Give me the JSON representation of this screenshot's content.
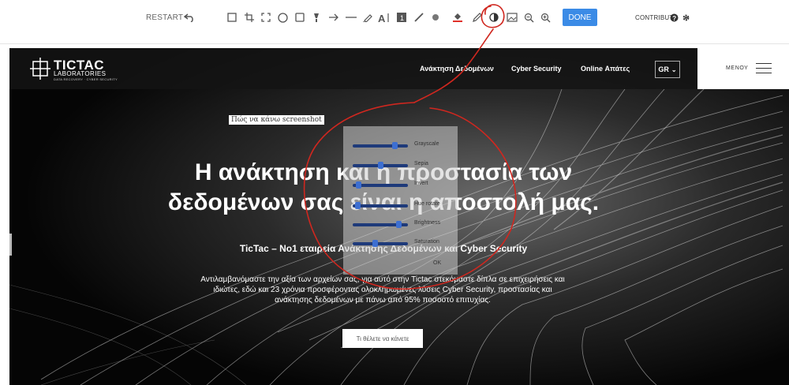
{
  "toolbar": {
    "restart_label": "RESTART",
    "done_label": "DONE",
    "contribute_label": "CONTRIBUTE",
    "tools": [
      "undo-icon",
      "rectangle-select-icon",
      "crop-icon",
      "fit-icon",
      "circle-icon",
      "square-icon",
      "highlight-icon",
      "arrow-icon",
      "line-icon",
      "pen-icon",
      "text-icon",
      "number-icon",
      "blur-icon",
      "dot-icon",
      "fill-icon",
      "pencil-icon",
      "filter-icon",
      "image-icon",
      "zoom-out-icon",
      "zoom-in-icon"
    ]
  },
  "site": {
    "logo_main": "TICTAC",
    "logo_sub": "LABORATORIES",
    "logo_tag": "DATA RECOVERY · CYBER SECURITY",
    "nav": [
      "Ανάκτηση Δεδομένων",
      "Cyber Security",
      "Online Απάτες"
    ],
    "lang": "GR",
    "menu_label": "ΜΕΝΟΥ"
  },
  "hero": {
    "screenshot_tag": "Πώς να κάνω screenshot",
    "title_line1": "Η ανάκτηση και η προστασία των",
    "title_line2": "δεδομένων σας είναι η αποστολή μας.",
    "subtitle": "TicTac – No1 εταιρεία Ανάκτησης Δεδομένων και Cyber Security",
    "paragraph": "Αντιλαμβανόμαστε την αξία των αρχείων σας, για αυτό στην Tictac στεκόμαστε δίπλα σε επιχειρήσεις και ιδιώτες, εδώ και 23 χρόνια προσφέροντας ολοκληρωμένες λύσεις Cyber Security, προστασίας και ανάκτησης δεδομένων με πάνω από 95% ποσοστό επιτυχίας.",
    "cta": "Τι θέλετε να κάνετε"
  },
  "filters": {
    "items": [
      {
        "label": "Grayscale",
        "value": 0.8
      },
      {
        "label": "Sepia",
        "value": 0.5
      },
      {
        "label": "Invert",
        "value": 0.07
      },
      {
        "label": "Hue rotate",
        "value": 0.05
      },
      {
        "label": "Brightness",
        "value": 0.88
      },
      {
        "label": "Saturation",
        "value": 0.4
      }
    ],
    "ok_label": "OK"
  },
  "colors": {
    "done_bg": "#3b8be6",
    "annotation": "#d0271f",
    "slider_track": "#1e3a7a",
    "slider_thumb": "#3d6fd1"
  }
}
